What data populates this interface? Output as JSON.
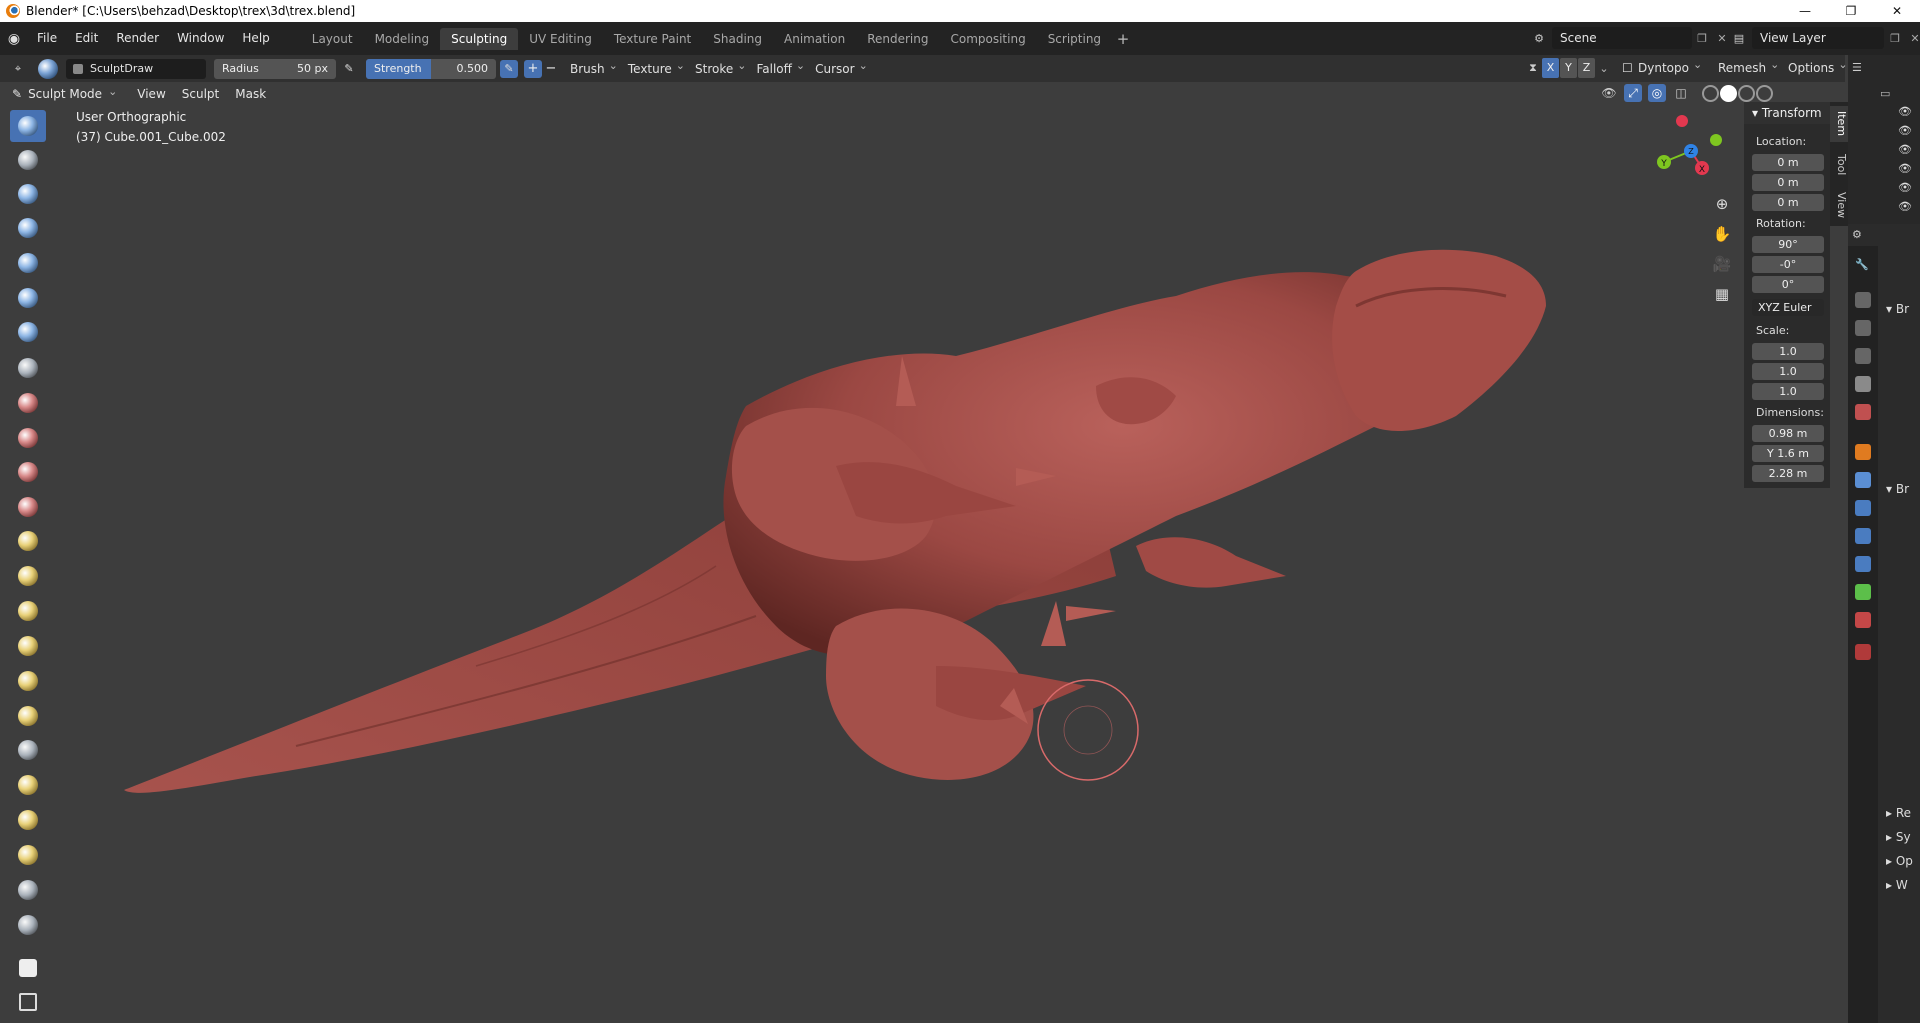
{
  "window": {
    "title": "Blender* [C:\\Users\\behzad\\Desktop\\trex\\3d\\trex.blend]",
    "controls": [
      "—",
      "❐",
      "✕"
    ]
  },
  "menus": [
    "File",
    "Edit",
    "Render",
    "Window",
    "Help"
  ],
  "workspaces": [
    {
      "label": "Layout",
      "active": false
    },
    {
      "label": "Modeling",
      "active": false
    },
    {
      "label": "Sculpting",
      "active": true
    },
    {
      "label": "UV Editing",
      "active": false
    },
    {
      "label": "Texture Paint",
      "active": false
    },
    {
      "label": "Shading",
      "active": false
    },
    {
      "label": "Animation",
      "active": false
    },
    {
      "label": "Rendering",
      "active": false
    },
    {
      "label": "Compositing",
      "active": false
    },
    {
      "label": "Scripting",
      "active": false
    }
  ],
  "scene": {
    "label": "Scene",
    "view_layer": "View Layer"
  },
  "tool_header": {
    "brush_name": "SculptDraw",
    "radius_label": "Radius",
    "radius_value": "50 px",
    "strength_label": "Strength",
    "strength_value": "0.500",
    "strength_fill": 0.5,
    "dropdowns": [
      "Brush",
      "Texture",
      "Stroke",
      "Falloff",
      "Cursor"
    ],
    "axes": [
      "X",
      "Y",
      "Z"
    ],
    "dyntopo": "Dyntopo",
    "remesh": "Remesh",
    "options": "Options"
  },
  "mode_header": {
    "mode": "Sculpt Mode",
    "menus": [
      "View",
      "Sculpt",
      "Mask"
    ]
  },
  "viewport": {
    "view_name": "User Orthographic",
    "object_info": "(37) Cube.001_Cube.002",
    "mesh_color": "#a04a45",
    "background": "#3d3d3d"
  },
  "n_panel": {
    "section": "Transform",
    "location_label": "Location:",
    "location": [
      "0 m",
      "0 m",
      "0 m"
    ],
    "rotation_label": "Rotation:",
    "rotation": [
      "90°",
      "-0°",
      "0°"
    ],
    "rotation_mode": "XYZ Euler",
    "scale_label": "Scale:",
    "scale": [
      "1.0",
      "1.0",
      "1.0"
    ],
    "dimensions_label": "Dimensions:",
    "dimensions": [
      "0.98 m",
      "Y  1.6 m",
      "2.28 m"
    ],
    "tabs": [
      "Item",
      "Tool",
      "View"
    ]
  },
  "properties": {
    "rows": [
      "Br",
      "Br",
      "Re",
      "Sy",
      "Op",
      "W"
    ]
  },
  "gizmo": {
    "x": "X",
    "y": "Y",
    "z": "Z",
    "x_color": "#e3384f",
    "y_color": "#7ec620",
    "z_color": "#2f83e6"
  }
}
